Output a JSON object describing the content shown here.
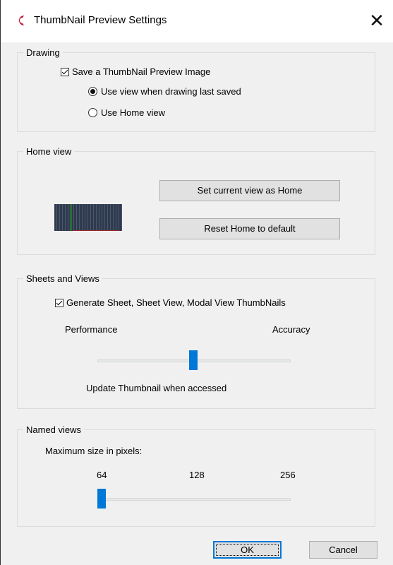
{
  "window": {
    "title": "ThumbNail Preview Settings",
    "close_glyph": "✕",
    "icon": "app-c-logo-icon",
    "icon_color": "#c8102e"
  },
  "drawing": {
    "label": "Drawing",
    "save_preview": {
      "label": "Save a ThumbNail Preview Image",
      "checked": true
    },
    "radios": [
      {
        "label": "Use view when drawing last saved",
        "checked": true
      },
      {
        "label": "Use Home view",
        "checked": false
      }
    ]
  },
  "home_view": {
    "label": "Home view",
    "set_button": "Set current view as Home",
    "reset_button": "Reset Home to default"
  },
  "sheets_views": {
    "label": "Sheets and Views",
    "generate": {
      "label": "Generate Sheet, Sheet View, Modal View ThumbNails",
      "checked": true
    },
    "left_label": "Performance",
    "right_label": "Accuracy",
    "slider_position": 0.5,
    "caption": "Update Thumbnail when accessed"
  },
  "named_views": {
    "label": "Named views",
    "subtitle": "Maximum size in pixels:",
    "ticks": [
      "64",
      "128",
      "256"
    ],
    "selected": "64"
  },
  "footer": {
    "ok": "OK",
    "cancel": "Cancel"
  },
  "colors": {
    "accent": "#0078d7",
    "background": "#f0f0f0"
  }
}
